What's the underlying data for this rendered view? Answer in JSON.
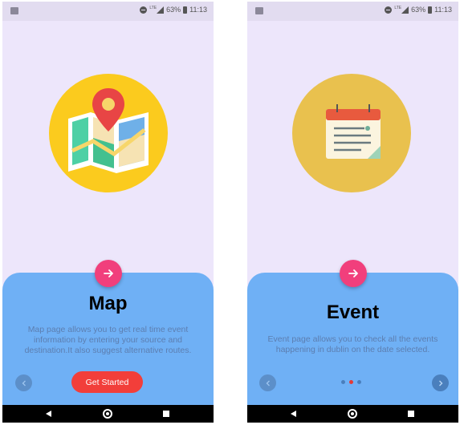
{
  "status_bar": {
    "lte_label": "LTE",
    "battery": "63%",
    "time": "11:13"
  },
  "screens": [
    {
      "title": "Map",
      "description": "Map page allows you to get real time event information by entering your source and destination.It also suggest alternative routes.",
      "illustration": "map-pin-icon",
      "hero_color": "#fbcb1e",
      "primary_button": "Get Started"
    },
    {
      "title": "Event",
      "description": "Event page allows you to check all the events happening in dublin on the date selected.",
      "illustration": "calendar-notes-icon",
      "hero_color": "#e9c14e",
      "page_indicator": {
        "count": 3,
        "active_index": 1
      }
    }
  ],
  "colors": {
    "background": "#ede6fb",
    "panel": "#6fb0f5",
    "fab": "#f13f7c",
    "button": "#f23e3a",
    "active_dot": "#e53935"
  }
}
